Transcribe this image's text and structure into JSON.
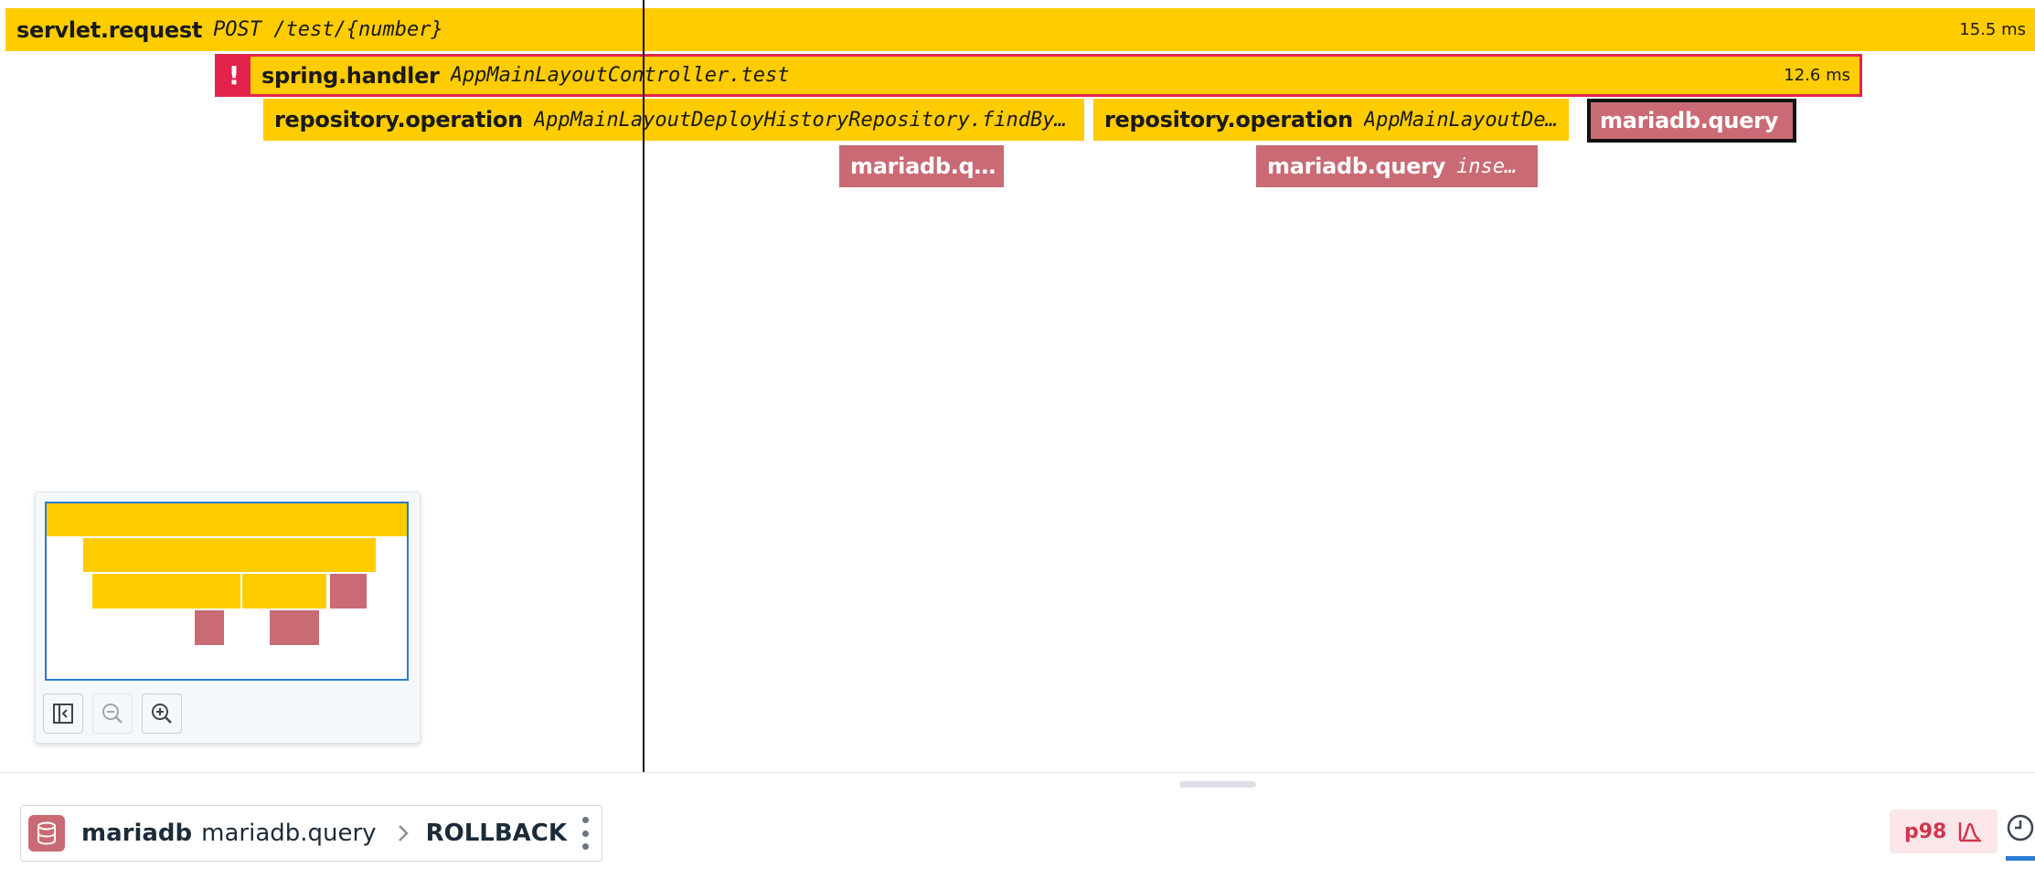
{
  "flame": {
    "spans": [
      {
        "service": "servlet.request",
        "resource": "POST /test/{number}",
        "duration": "15.5 ms"
      },
      {
        "service": "spring.handler",
        "resource": "AppMainLayoutController.test",
        "duration": "12.6 ms",
        "error_mark": "!"
      },
      {
        "service": "repository.operation",
        "resource": "AppMainLayoutDeployHistoryRepository.findById"
      },
      {
        "service": "repository.operation",
        "resource": "AppMainLayoutDep…"
      },
      {
        "service": "mariadb.query",
        "resource": "…"
      },
      {
        "service": "mariadb.q…",
        "resource": ""
      },
      {
        "service": "mariadb.query",
        "resource": "insert…"
      }
    ]
  },
  "minimap": {
    "controls": [
      {
        "icon": "collapse-panel-icon",
        "enabled": true
      },
      {
        "icon": "zoom-out-icon",
        "enabled": false
      },
      {
        "icon": "zoom-in-icon",
        "enabled": true
      }
    ]
  },
  "bottom": {
    "breadcrumb": {
      "icon": "database-icon",
      "service": "mariadb",
      "name": "mariadb.query",
      "resource": "ROLLBACK"
    },
    "p98_label": "p98"
  },
  "colors": {
    "span_yellow": "#ffcc00",
    "span_db": "#c96a75",
    "error": "#e3234b",
    "accent": "#2a7bd1"
  }
}
